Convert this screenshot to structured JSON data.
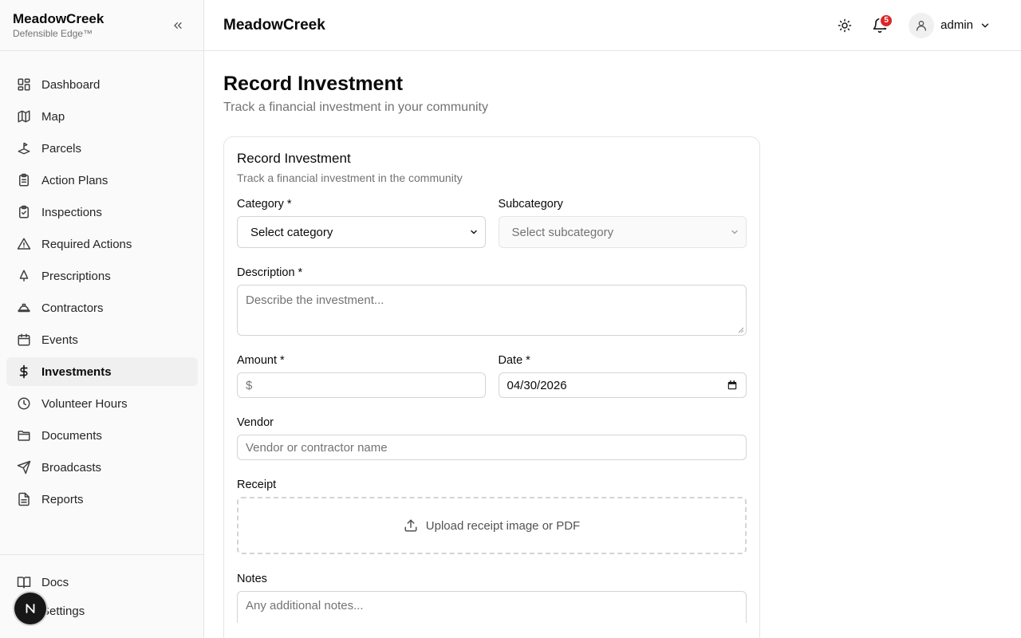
{
  "brand": {
    "name": "MeadowCreek",
    "tagline": "Defensible Edge™"
  },
  "sidebar": {
    "items": [
      {
        "label": "Dashboard",
        "icon": "dashboard-icon"
      },
      {
        "label": "Map",
        "icon": "map-icon"
      },
      {
        "label": "Parcels",
        "icon": "parcels-icon"
      },
      {
        "label": "Action Plans",
        "icon": "clipboard-list-icon"
      },
      {
        "label": "Inspections",
        "icon": "clipboard-check-icon"
      },
      {
        "label": "Required Actions",
        "icon": "warning-triangle-icon"
      },
      {
        "label": "Prescriptions",
        "icon": "tree-icon"
      },
      {
        "label": "Contractors",
        "icon": "hard-hat-icon"
      },
      {
        "label": "Events",
        "icon": "calendar-icon"
      },
      {
        "label": "Investments",
        "icon": "dollar-icon",
        "active": true
      },
      {
        "label": "Volunteer Hours",
        "icon": "clock-icon"
      },
      {
        "label": "Documents",
        "icon": "folder-icon"
      },
      {
        "label": "Broadcasts",
        "icon": "send-icon"
      },
      {
        "label": "Reports",
        "icon": "file-text-icon"
      }
    ],
    "footer": [
      {
        "label": "Docs",
        "icon": "book-icon"
      },
      {
        "label": "Settings",
        "icon": "gear-icon"
      }
    ],
    "floating_avatar": "N"
  },
  "header": {
    "title": "MeadowCreek",
    "notification_count": "5",
    "user": "admin"
  },
  "page": {
    "title": "Record Investment",
    "subtitle": "Track a financial investment in your community"
  },
  "form": {
    "title": "Record Investment",
    "subtitle": "Track a financial investment in the community",
    "category": {
      "label": "Category *",
      "value": "Select category"
    },
    "subcategory": {
      "label": "Subcategory",
      "value": "Select subcategory"
    },
    "description": {
      "label": "Description *",
      "placeholder": "Describe the investment..."
    },
    "amount": {
      "label": "Amount *",
      "prefix": "$"
    },
    "date": {
      "label": "Date *",
      "value": "04/30/2026"
    },
    "vendor": {
      "label": "Vendor",
      "placeholder": "Vendor or contractor name"
    },
    "receipt": {
      "label": "Receipt",
      "upload_text": "Upload receipt image or PDF"
    },
    "notes": {
      "label": "Notes",
      "placeholder": "Any additional notes..."
    }
  }
}
